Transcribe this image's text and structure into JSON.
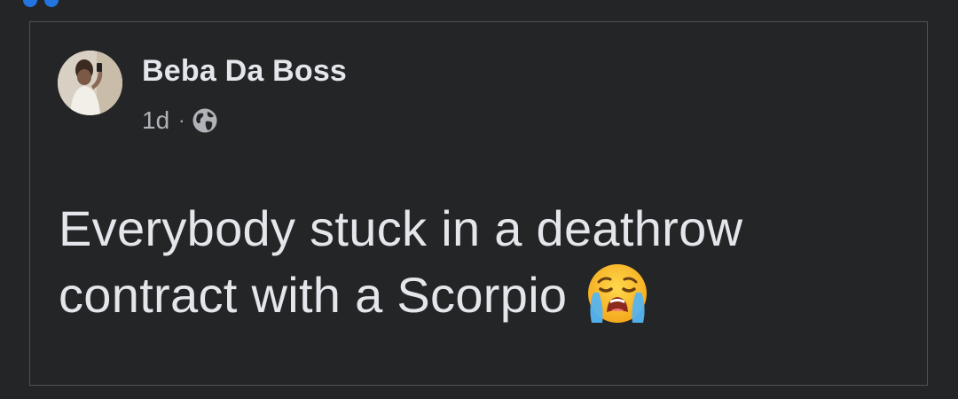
{
  "post": {
    "author": "Beba Da Boss",
    "timestamp": "1d",
    "separator": "·",
    "audience_icon": "globe-icon",
    "text": "Everybody stuck in a deathrow contract with a Scorpio",
    "emoji_icon": "crying-face-emoji-icon"
  },
  "colors": {
    "background": "#242526",
    "card_border": "#505152",
    "primary_text": "#e4e6eb",
    "secondary_text": "#b0b3b8"
  }
}
